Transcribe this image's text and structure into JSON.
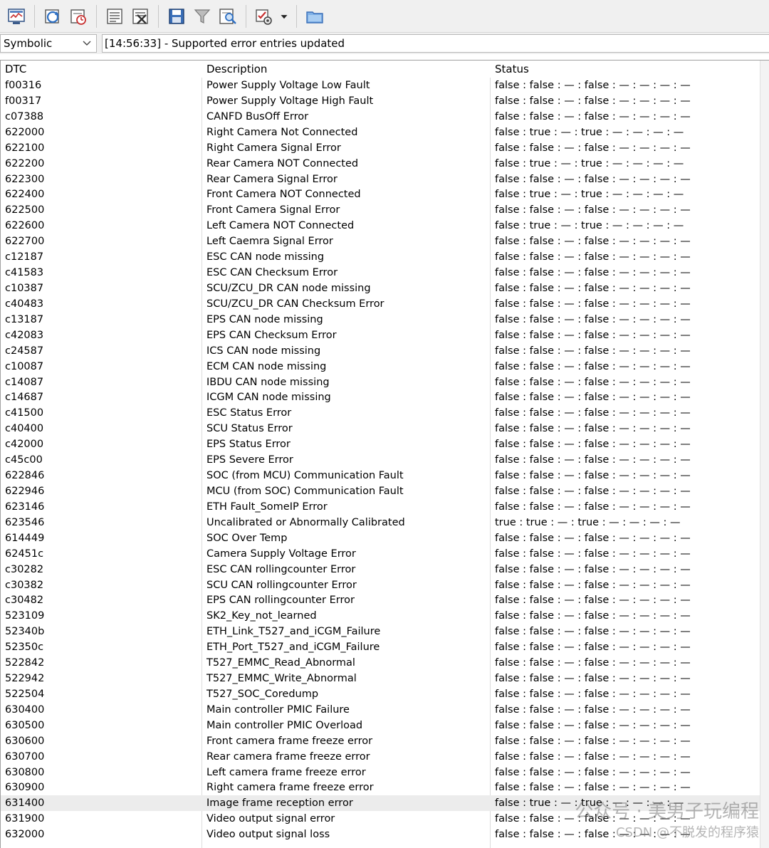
{
  "toolbar": {
    "icons": [
      "monitor-window-icon",
      "refresh-list-icon",
      "refresh-clock-icon",
      "document-list-icon",
      "clear-document-icon",
      "save-disk-icon",
      "filter-icon",
      "find-in-list-icon",
      "checklist-settings-icon",
      "dropdown-arrow-icon",
      "open-folder-icon"
    ]
  },
  "controls": {
    "view_mode": "Symbolic",
    "status_message": "[14:56:33] - Supported error entries updated"
  },
  "table": {
    "columns": [
      "DTC",
      "Description",
      "Status"
    ],
    "selected_row": 46,
    "rows": [
      {
        "dtc": "f00316",
        "description": "Power Supply Voltage Low Fault",
        "status": "false : false : — : false : — : — : — : —"
      },
      {
        "dtc": "f00317",
        "description": "Power Supply Voltage High Fault",
        "status": "false : false : — : false : — : — : — : —"
      },
      {
        "dtc": "c07388",
        "description": "CANFD BusOff Error",
        "status": "false : false : — : false : — : — : — : —"
      },
      {
        "dtc": "622000",
        "description": "Right Camera Not Connected",
        "status": "false : true : — : true : — : — : — : —"
      },
      {
        "dtc": "622100",
        "description": "Right Camera Signal Error",
        "status": "false : false : — : false : — : — : — : —"
      },
      {
        "dtc": "622200",
        "description": "Rear Camera NOT Connected",
        "status": "false : true : — : true : — : — : — : —"
      },
      {
        "dtc": "622300",
        "description": "Rear Camera Signal Error",
        "status": "false : false : — : false : — : — : — : —"
      },
      {
        "dtc": "622400",
        "description": "Front Camera NOT Connected",
        "status": "false : true : — : true : — : — : — : —"
      },
      {
        "dtc": "622500",
        "description": "Front Camera Signal Error",
        "status": "false : false : — : false : — : — : — : —"
      },
      {
        "dtc": "622600",
        "description": "Left Camera NOT Connected",
        "status": "false : true : — : true : — : — : — : —"
      },
      {
        "dtc": "622700",
        "description": "Left Caemra Signal Error",
        "status": "false : false : — : false : — : — : — : —"
      },
      {
        "dtc": "c12187",
        "description": "ESC CAN node missing",
        "status": "false : false : — : false : — : — : — : —"
      },
      {
        "dtc": "c41583",
        "description": "ESC CAN Checksum Error",
        "status": "false : false : — : false : — : — : — : —"
      },
      {
        "dtc": "c10387",
        "description": "SCU/ZCU_DR CAN node missing",
        "status": "false : false : — : false : — : — : — : —"
      },
      {
        "dtc": "c40483",
        "description": "SCU/ZCU_DR CAN Checksum Error",
        "status": "false : false : — : false : — : — : — : —"
      },
      {
        "dtc": "c13187",
        "description": "EPS CAN node missing",
        "status": "false : false : — : false : — : — : — : —"
      },
      {
        "dtc": "c42083",
        "description": "EPS CAN Checksum Error",
        "status": "false : false : — : false : — : — : — : —"
      },
      {
        "dtc": "c24587",
        "description": "ICS CAN node missing",
        "status": "false : false : — : false : — : — : — : —"
      },
      {
        "dtc": "c10087",
        "description": "ECM CAN node missing",
        "status": "false : false : — : false : — : — : — : —"
      },
      {
        "dtc": "c14087",
        "description": "IBDU CAN node missing",
        "status": "false : false : — : false : — : — : — : —"
      },
      {
        "dtc": "c14687",
        "description": "ICGM CAN node missing",
        "status": "false : false : — : false : — : — : — : —"
      },
      {
        "dtc": "c41500",
        "description": "ESC Status Error",
        "status": "false : false : — : false : — : — : — : —"
      },
      {
        "dtc": "c40400",
        "description": "SCU Status Error",
        "status": "false : false : — : false : — : — : — : —"
      },
      {
        "dtc": "c42000",
        "description": "EPS Status Error",
        "status": "false : false : — : false : — : — : — : —"
      },
      {
        "dtc": "c45c00",
        "description": "EPS Severe Error",
        "status": "false : false : — : false : — : — : — : —"
      },
      {
        "dtc": "622846",
        "description": "SOC (from MCU) Communication Fault",
        "status": "false : false : — : false : — : — : — : —"
      },
      {
        "dtc": "622946",
        "description": "MCU (from SOC) Communication Fault",
        "status": "false : false : — : false : — : — : — : —"
      },
      {
        "dtc": "623146",
        "description": "ETH Fault_SomeIP Error",
        "status": "false : false : — : false : — : — : — : —"
      },
      {
        "dtc": "623546",
        "description": "Uncalibrated or Abnormally Calibrated",
        "status": "true : true : — : true : — : — : — : —"
      },
      {
        "dtc": "614449",
        "description": "SOC Over Temp",
        "status": "false : false : — : false : — : — : — : —"
      },
      {
        "dtc": "62451c",
        "description": "Camera  Supply Voltage Error",
        "status": "false : false : — : false : — : — : — : —"
      },
      {
        "dtc": "c30282",
        "description": "ESC CAN rollingcounter Error",
        "status": "false : false : — : false : — : — : — : —"
      },
      {
        "dtc": "c30382",
        "description": "SCU CAN rollingcounter Error",
        "status": "false : false : — : false : — : — : — : —"
      },
      {
        "dtc": "c30482",
        "description": "EPS CAN rollingcounter Error",
        "status": "false : false : — : false : — : — : — : —"
      },
      {
        "dtc": "523109",
        "description": "SK2_Key_not_learned",
        "status": "false : false : — : false : — : — : — : —"
      },
      {
        "dtc": "52340b",
        "description": "ETH_Link_T527_and_iCGM_Failure",
        "status": "false : false : — : false : — : — : — : —"
      },
      {
        "dtc": "52350c",
        "description": "ETH_Port_T527_and_iCGM_Failure",
        "status": "false : false : — : false : — : — : — : —"
      },
      {
        "dtc": "522842",
        "description": "T527_EMMC_Read_Abnormal",
        "status": "false : false : — : false : — : — : — : —"
      },
      {
        "dtc": "522942",
        "description": "T527_EMMC_Write_Abnormal",
        "status": "false : false : — : false : — : — : — : —"
      },
      {
        "dtc": "522504",
        "description": "T527_SOC_Coredump",
        "status": "false : false : — : false : — : — : — : —"
      },
      {
        "dtc": "630400",
        "description": "Main controller PMIC Failure",
        "status": "false : false : — : false : — : — : — : —"
      },
      {
        "dtc": "630500",
        "description": "Main controller PMIC Overload",
        "status": "false : false : — : false : — : — : — : —"
      },
      {
        "dtc": "630600",
        "description": "Front camera frame freeze error",
        "status": "false : false : — : false : — : — : — : —"
      },
      {
        "dtc": "630700",
        "description": "Rear camera frame freeze error",
        "status": "false : false : — : false : — : — : — : —"
      },
      {
        "dtc": "630800",
        "description": "Left camera frame freeze error",
        "status": "false : false : — : false : — : — : — : —"
      },
      {
        "dtc": "630900",
        "description": "Right camera frame freeze error",
        "status": "false : false : — : false : — : — : — : —"
      },
      {
        "dtc": "631400",
        "description": "Image frame reception error",
        "status": "false : true : — : true : — : — : — : —"
      },
      {
        "dtc": "631900",
        "description": " Video output signal error",
        "status": "false : false : — : false : — : — : — : —"
      },
      {
        "dtc": "632000",
        "description": "Video output signal loss",
        "status": "false : false : — : false : — : — : — : —"
      }
    ]
  },
  "watermark": {
    "line1": "公众号 · 美男子玩编程",
    "line2": "CSDN @不脱发的程序猿"
  }
}
